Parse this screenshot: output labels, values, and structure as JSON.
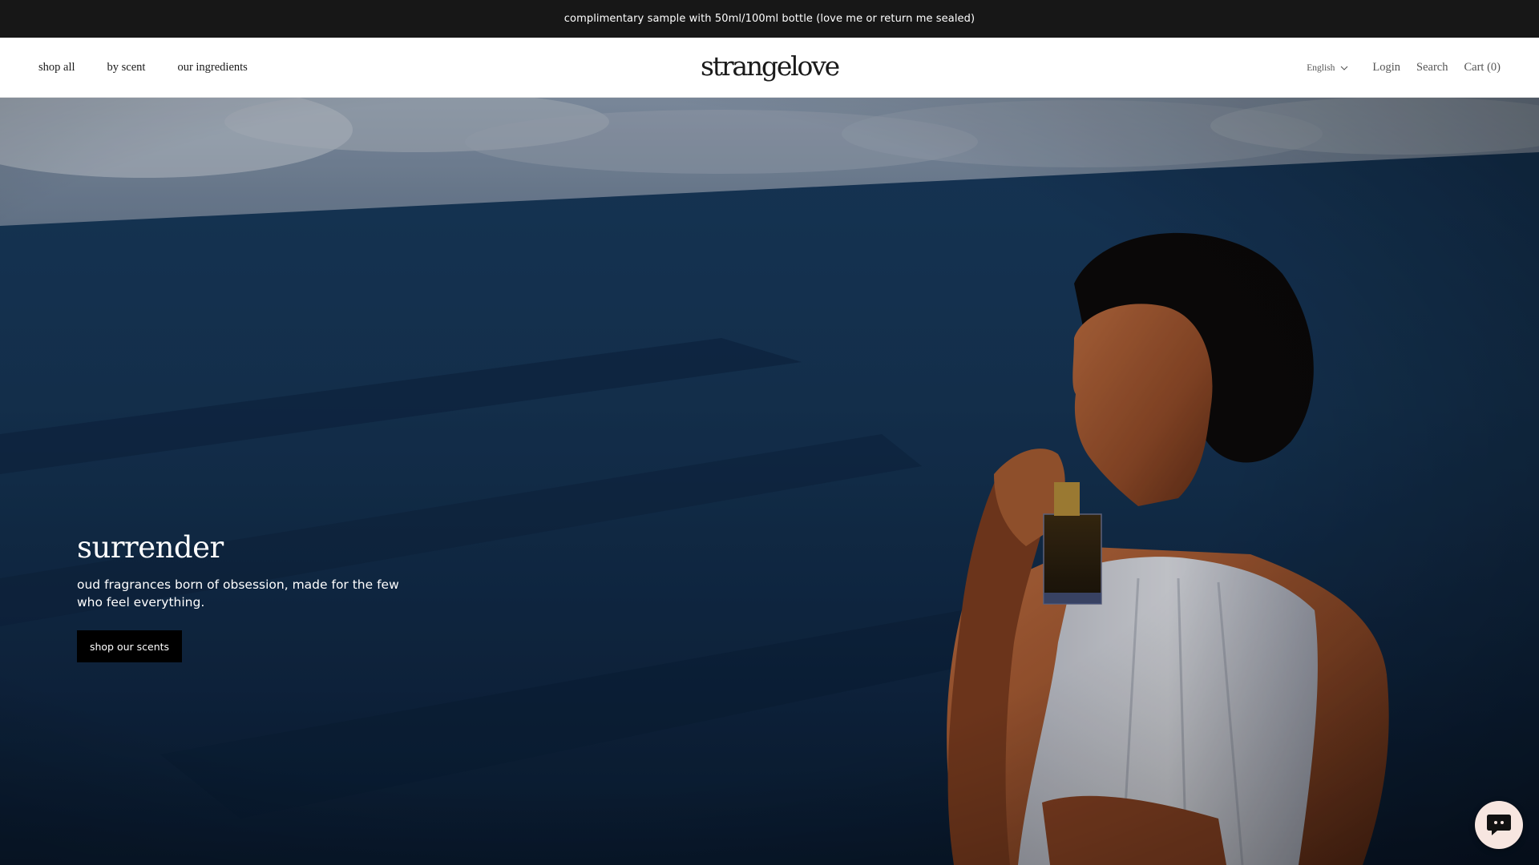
{
  "announcement": {
    "text": "complimentary sample with 50ml/100ml bottle (love me or return me sealed)"
  },
  "header": {
    "logo": "strangelove",
    "nav_left": [
      "shop all",
      "by scent",
      "our ingredients"
    ],
    "language": "English",
    "login": "Login",
    "search": "Search",
    "cart": "Cart (0)"
  },
  "hero": {
    "title": "surrender",
    "subtitle": "oud fragrances born of obsession, made for the few who feel everything.",
    "button": "shop our scents"
  },
  "icons": {
    "language_dropdown": "chevron-down-icon",
    "chat": "chat-icon"
  },
  "colors": {
    "announcement_bg": "#171717",
    "header_bg": "#ffffff",
    "button_bg": "#000000",
    "chat_bg": "#f7e6e0"
  }
}
